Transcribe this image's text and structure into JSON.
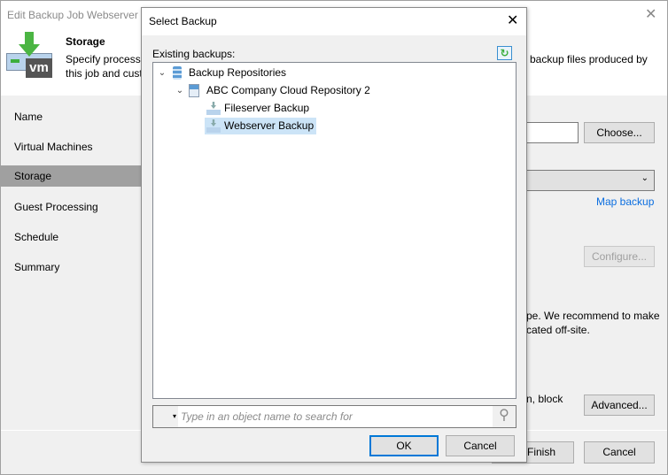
{
  "window": {
    "title": "Edit Backup Job Webserver B",
    "close": "✕"
  },
  "header": {
    "title": "Storage",
    "desc_line1": "Specify processi",
    "desc_line2": "this job and cust",
    "desc_right": "backup files produced by",
    "icon_text": "vm"
  },
  "nav": [
    {
      "label": "Name"
    },
    {
      "label": "Virtual Machines"
    },
    {
      "label": "Storage",
      "selected": true
    },
    {
      "label": "Guest Processing"
    },
    {
      "label": "Schedule"
    },
    {
      "label": "Summary"
    }
  ],
  "main": {
    "choose": "Choose...",
    "map_backup": "Map backup",
    "configure": "Configure...",
    "text1": "pe. We recommend to make",
    "text2": "cated off-site.",
    "text3": "n, block",
    "advanced": "Advanced...",
    "finish": "Finish",
    "cancel": "Cancel",
    "link_color": "#0b6ee0"
  },
  "dialog": {
    "title": "Select Backup",
    "close": "✕",
    "label": "Existing backups:",
    "tree": [
      {
        "label": "Backup Repositories",
        "level": 0,
        "expanded": true
      },
      {
        "label": "ABC Company Cloud Repository 2",
        "level": 1,
        "expanded": true
      },
      {
        "label": "Fileserver Backup",
        "level": 2
      },
      {
        "label": "Webserver Backup",
        "level": 2,
        "selected": true
      }
    ],
    "search_placeholder": "Type in an object name to search for",
    "ok": "OK",
    "cancel": "Cancel"
  }
}
